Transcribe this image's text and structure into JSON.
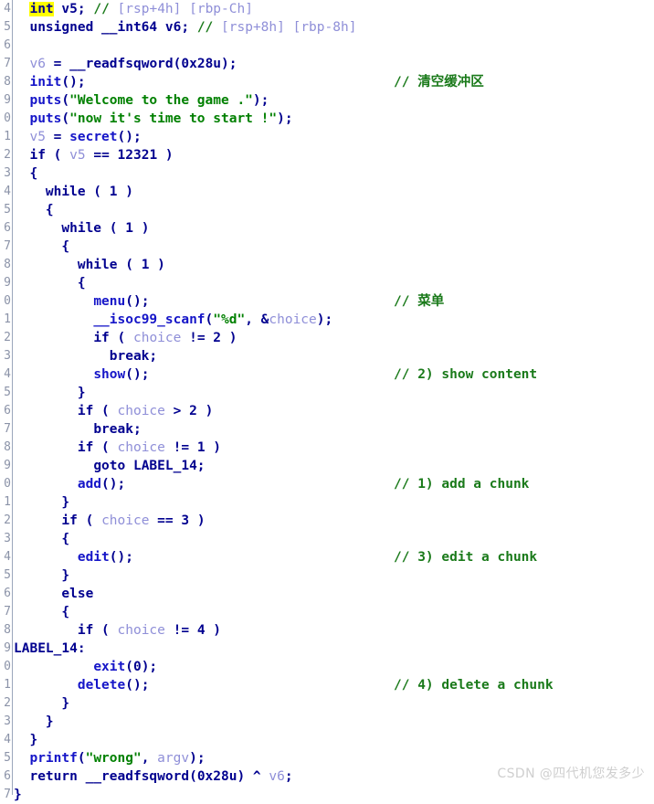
{
  "editor": {
    "name": "ida-pseudocode-view",
    "background": "#ffffff",
    "line_height_px": 20,
    "colors": {
      "keyword": "#00008f",
      "function": "#1515c8",
      "variable": "#8f8fd8",
      "string": "#008000",
      "comment": "#1a7a1a",
      "highlight": "#ffff00",
      "gutter_text": "#8b93a8",
      "gutter_rule": "#9aa6bb",
      "watermark": "#cfcfcf"
    }
  },
  "gutter": {
    "note": "line numbers are clipped by the left edge; only the final digit of each number is visible",
    "digits": [
      "4",
      "5",
      "6",
      "7",
      "8",
      "9",
      "0",
      "1",
      "2",
      "3",
      "4",
      "5",
      "6",
      "7",
      "8",
      "9",
      "0",
      "1",
      "2",
      "3",
      "4",
      "5",
      "6",
      "7",
      "8",
      "9",
      "0",
      "1",
      "2",
      "3",
      "4",
      "5",
      "6",
      "7",
      "8",
      "9",
      "0",
      "1",
      "2",
      "3",
      "4",
      "5",
      "6",
      "7"
    ]
  },
  "code": {
    "lines": [
      {
        "indent": 2,
        "tokens": [
          {
            "t": "int",
            "c": "kw-hl"
          },
          {
            "t": " ",
            "c": "plain"
          },
          {
            "t": "v5",
            "c": "plain"
          },
          {
            "t": "; ",
            "c": "punct"
          },
          {
            "t": "// ",
            "c": "cmt"
          },
          {
            "t": "[rsp+4h] [rbp-Ch]",
            "c": "var"
          }
        ]
      },
      {
        "indent": 2,
        "tokens": [
          {
            "t": "unsigned __int64",
            "c": "kw"
          },
          {
            "t": " v6",
            "c": "plain"
          },
          {
            "t": "; ",
            "c": "punct"
          },
          {
            "t": "// ",
            "c": "cmt"
          },
          {
            "t": "[rsp+8h] [rbp-8h]",
            "c": "var"
          }
        ]
      },
      {
        "indent": 0,
        "tokens": []
      },
      {
        "indent": 2,
        "tokens": [
          {
            "t": "v6",
            "c": "var"
          },
          {
            "t": " = ",
            "c": "plain"
          },
          {
            "t": "__readfsqword",
            "c": "plain"
          },
          {
            "t": "(",
            "c": "punct"
          },
          {
            "t": "0x28u",
            "c": "num"
          },
          {
            "t": ");",
            "c": "punct"
          }
        ]
      },
      {
        "indent": 2,
        "tokens": [
          {
            "t": "init",
            "c": "fn"
          },
          {
            "t": "();",
            "c": "punct"
          }
        ]
      },
      {
        "indent": 2,
        "tokens": [
          {
            "t": "puts",
            "c": "fn"
          },
          {
            "t": "(",
            "c": "punct"
          },
          {
            "t": "\"Welcome to the game .\"",
            "c": "str"
          },
          {
            "t": ");",
            "c": "punct"
          }
        ]
      },
      {
        "indent": 2,
        "tokens": [
          {
            "t": "puts",
            "c": "fn"
          },
          {
            "t": "(",
            "c": "punct"
          },
          {
            "t": "\"now it's time to start !\"",
            "c": "str"
          },
          {
            "t": ");",
            "c": "punct"
          }
        ]
      },
      {
        "indent": 2,
        "tokens": [
          {
            "t": "v5",
            "c": "var"
          },
          {
            "t": " = ",
            "c": "plain"
          },
          {
            "t": "secret",
            "c": "fn"
          },
          {
            "t": "();",
            "c": "punct"
          }
        ]
      },
      {
        "indent": 2,
        "tokens": [
          {
            "t": "if",
            "c": "kw"
          },
          {
            "t": " ( ",
            "c": "punct"
          },
          {
            "t": "v5",
            "c": "var"
          },
          {
            "t": " == ",
            "c": "plain"
          },
          {
            "t": "12321",
            "c": "num"
          },
          {
            "t": " )",
            "c": "punct"
          }
        ]
      },
      {
        "indent": 2,
        "tokens": [
          {
            "t": "{",
            "c": "punct"
          }
        ]
      },
      {
        "indent": 4,
        "tokens": [
          {
            "t": "while",
            "c": "kw"
          },
          {
            "t": " ( ",
            "c": "punct"
          },
          {
            "t": "1",
            "c": "num"
          },
          {
            "t": " )",
            "c": "punct"
          }
        ]
      },
      {
        "indent": 4,
        "tokens": [
          {
            "t": "{",
            "c": "punct"
          }
        ]
      },
      {
        "indent": 6,
        "tokens": [
          {
            "t": "while",
            "c": "kw"
          },
          {
            "t": " ( ",
            "c": "punct"
          },
          {
            "t": "1",
            "c": "num"
          },
          {
            "t": " )",
            "c": "punct"
          }
        ]
      },
      {
        "indent": 6,
        "tokens": [
          {
            "t": "{",
            "c": "punct"
          }
        ]
      },
      {
        "indent": 8,
        "tokens": [
          {
            "t": "while",
            "c": "kw"
          },
          {
            "t": " ( ",
            "c": "punct"
          },
          {
            "t": "1",
            "c": "num"
          },
          {
            "t": " )",
            "c": "punct"
          }
        ]
      },
      {
        "indent": 8,
        "tokens": [
          {
            "t": "{",
            "c": "punct"
          }
        ]
      },
      {
        "indent": 10,
        "tokens": [
          {
            "t": "menu",
            "c": "fn"
          },
          {
            "t": "();",
            "c": "punct"
          }
        ]
      },
      {
        "indent": 10,
        "tokens": [
          {
            "t": "__isoc99_scanf",
            "c": "fn"
          },
          {
            "t": "(",
            "c": "punct"
          },
          {
            "t": "\"%d\"",
            "c": "str"
          },
          {
            "t": ", &",
            "c": "punct"
          },
          {
            "t": "choice",
            "c": "var"
          },
          {
            "t": ");",
            "c": "punct"
          }
        ]
      },
      {
        "indent": 10,
        "tokens": [
          {
            "t": "if",
            "c": "kw"
          },
          {
            "t": " ( ",
            "c": "punct"
          },
          {
            "t": "choice",
            "c": "var"
          },
          {
            "t": " != ",
            "c": "plain"
          },
          {
            "t": "2",
            "c": "num"
          },
          {
            "t": " )",
            "c": "punct"
          }
        ]
      },
      {
        "indent": 12,
        "tokens": [
          {
            "t": "break",
            "c": "kw"
          },
          {
            "t": ";",
            "c": "punct"
          }
        ]
      },
      {
        "indent": 10,
        "tokens": [
          {
            "t": "show",
            "c": "fn"
          },
          {
            "t": "();",
            "c": "punct"
          }
        ]
      },
      {
        "indent": 8,
        "tokens": [
          {
            "t": "}",
            "c": "punct"
          }
        ]
      },
      {
        "indent": 8,
        "tokens": [
          {
            "t": "if",
            "c": "kw"
          },
          {
            "t": " ( ",
            "c": "punct"
          },
          {
            "t": "choice",
            "c": "var"
          },
          {
            "t": " > ",
            "c": "plain"
          },
          {
            "t": "2",
            "c": "num"
          },
          {
            "t": " )",
            "c": "punct"
          }
        ]
      },
      {
        "indent": 10,
        "tokens": [
          {
            "t": "break",
            "c": "kw"
          },
          {
            "t": ";",
            "c": "punct"
          }
        ]
      },
      {
        "indent": 8,
        "tokens": [
          {
            "t": "if",
            "c": "kw"
          },
          {
            "t": " ( ",
            "c": "punct"
          },
          {
            "t": "choice",
            "c": "var"
          },
          {
            "t": " != ",
            "c": "plain"
          },
          {
            "t": "1",
            "c": "num"
          },
          {
            "t": " )",
            "c": "punct"
          }
        ]
      },
      {
        "indent": 10,
        "tokens": [
          {
            "t": "goto",
            "c": "kw"
          },
          {
            "t": " LABEL_14;",
            "c": "plain"
          }
        ]
      },
      {
        "indent": 8,
        "tokens": [
          {
            "t": "add",
            "c": "fn"
          },
          {
            "t": "();",
            "c": "punct"
          }
        ]
      },
      {
        "indent": 6,
        "tokens": [
          {
            "t": "}",
            "c": "punct"
          }
        ]
      },
      {
        "indent": 6,
        "tokens": [
          {
            "t": "if",
            "c": "kw"
          },
          {
            "t": " ( ",
            "c": "punct"
          },
          {
            "t": "choice",
            "c": "var"
          },
          {
            "t": " == ",
            "c": "plain"
          },
          {
            "t": "3",
            "c": "num"
          },
          {
            "t": " )",
            "c": "punct"
          }
        ]
      },
      {
        "indent": 6,
        "tokens": [
          {
            "t": "{",
            "c": "punct"
          }
        ]
      },
      {
        "indent": 8,
        "tokens": [
          {
            "t": "edit",
            "c": "fn"
          },
          {
            "t": "();",
            "c": "punct"
          }
        ]
      },
      {
        "indent": 6,
        "tokens": [
          {
            "t": "}",
            "c": "punct"
          }
        ]
      },
      {
        "indent": 6,
        "tokens": [
          {
            "t": "else",
            "c": "kw"
          }
        ]
      },
      {
        "indent": 6,
        "tokens": [
          {
            "t": "{",
            "c": "punct"
          }
        ]
      },
      {
        "indent": 8,
        "tokens": [
          {
            "t": "if",
            "c": "kw"
          },
          {
            "t": " ( ",
            "c": "punct"
          },
          {
            "t": "choice",
            "c": "var"
          },
          {
            "t": " != ",
            "c": "plain"
          },
          {
            "t": "4",
            "c": "num"
          },
          {
            "t": " )",
            "c": "punct"
          }
        ]
      },
      {
        "indent": 0,
        "tokens": [
          {
            "t": "LABEL_14:",
            "c": "label"
          }
        ]
      },
      {
        "indent": 10,
        "tokens": [
          {
            "t": "exit",
            "c": "fn"
          },
          {
            "t": "(",
            "c": "punct"
          },
          {
            "t": "0",
            "c": "num"
          },
          {
            "t": ");",
            "c": "punct"
          }
        ]
      },
      {
        "indent": 8,
        "tokens": [
          {
            "t": "delete",
            "c": "fn"
          },
          {
            "t": "();",
            "c": "punct"
          }
        ]
      },
      {
        "indent": 6,
        "tokens": [
          {
            "t": "}",
            "c": "punct"
          }
        ]
      },
      {
        "indent": 4,
        "tokens": [
          {
            "t": "}",
            "c": "punct"
          }
        ]
      },
      {
        "indent": 2,
        "tokens": [
          {
            "t": "}",
            "c": "punct"
          }
        ]
      },
      {
        "indent": 2,
        "tokens": [
          {
            "t": "printf",
            "c": "fn"
          },
          {
            "t": "(",
            "c": "punct"
          },
          {
            "t": "\"wrong\"",
            "c": "str"
          },
          {
            "t": ", ",
            "c": "punct"
          },
          {
            "t": "argv",
            "c": "var"
          },
          {
            "t": ");",
            "c": "punct"
          }
        ]
      },
      {
        "indent": 2,
        "tokens": [
          {
            "t": "return",
            "c": "kw"
          },
          {
            "t": " __readfsqword",
            "c": "plain"
          },
          {
            "t": "(",
            "c": "punct"
          },
          {
            "t": "0x28u",
            "c": "num"
          },
          {
            "t": ") ^ ",
            "c": "plain"
          },
          {
            "t": "v6",
            "c": "var"
          },
          {
            "t": ";",
            "c": "punct"
          }
        ]
      },
      {
        "indent": 0,
        "tokens": [
          {
            "t": "}",
            "c": "punct"
          }
        ]
      }
    ]
  },
  "side_comments": [
    {
      "row": 4,
      "text": "// 清空缓冲区"
    },
    {
      "row": 16,
      "text": "// 菜单"
    },
    {
      "row": 20,
      "text": "// 2) show content"
    },
    {
      "row": 26,
      "text": "// 1) add a chunk"
    },
    {
      "row": 30,
      "text": "// 3) edit a chunk"
    },
    {
      "row": 37,
      "text": "// 4) delete a chunk"
    }
  ],
  "watermark": {
    "text": "CSDN @四代机您发多少"
  }
}
